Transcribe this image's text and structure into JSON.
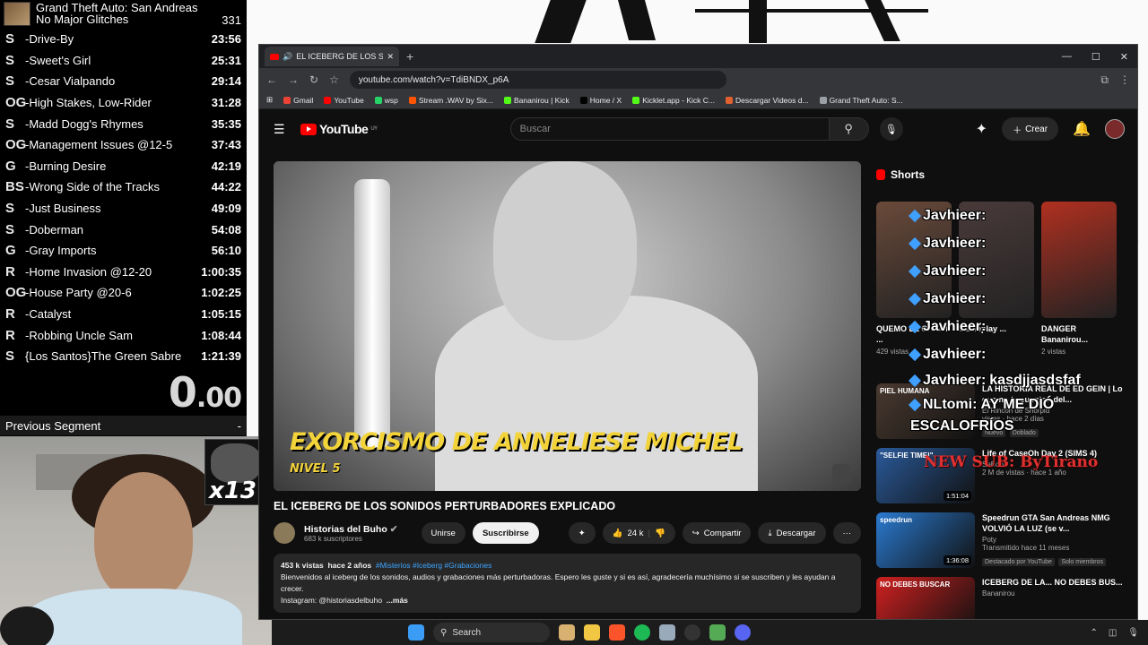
{
  "splits": {
    "game_title": "Grand Theft Auto: San Andreas",
    "category": "No Major Glitches",
    "attempts": "331",
    "rows": [
      {
        "icon": "S",
        "name": "-Drive-By",
        "time": "23:56"
      },
      {
        "icon": "S",
        "name": "-Sweet's Girl",
        "time": "25:31"
      },
      {
        "icon": "S",
        "name": "-Cesar Vialpando",
        "time": "29:14"
      },
      {
        "icon": "OG",
        "name": "-High Stakes, Low-Rider",
        "time": "31:28"
      },
      {
        "icon": "S",
        "name": "-Madd Dogg's Rhymes",
        "time": "35:35"
      },
      {
        "icon": "OG",
        "name": "-Management Issues @12-5",
        "time": "37:43"
      },
      {
        "icon": "G",
        "name": "-Burning Desire",
        "time": "42:19"
      },
      {
        "icon": "BS",
        "name": "-Wrong Side of the Tracks",
        "time": "44:22"
      },
      {
        "icon": "S",
        "name": "-Just Business",
        "time": "49:09"
      },
      {
        "icon": "S",
        "name": "-Doberman",
        "time": "54:08"
      },
      {
        "icon": "G",
        "name": "-Gray Imports",
        "time": "56:10"
      },
      {
        "icon": "R",
        "name": "-Home Invasion @12-20",
        "time": "1:00:35"
      },
      {
        "icon": "OG",
        "name": "-House Party @20-6",
        "time": "1:02:25"
      },
      {
        "icon": "R",
        "name": "-Catalyst",
        "time": "1:05:15"
      },
      {
        "icon": "R",
        "name": "-Robbing Uncle Sam",
        "time": "1:08:44"
      },
      {
        "icon": "S",
        "name": "{Los Santos}The Green Sabre",
        "time": "1:21:39"
      }
    ],
    "timer_main": "0",
    "timer_decimals": ".00",
    "previous_segment_label": "Previous Segment",
    "previous_segment_value": "-"
  },
  "webcam": {
    "sub_count": "x13"
  },
  "browser": {
    "tab_title": "EL ICEBERG DE LOS SONIDOS",
    "new_tab": "+",
    "url": "youtube.com/watch?v=TdiBNDX_p6A",
    "bookmarks": [
      {
        "label": "Gmail",
        "color": "#ea4335"
      },
      {
        "label": "YouTube",
        "color": "#ff0000"
      },
      {
        "label": "wsp",
        "color": "#25d366"
      },
      {
        "label": "Stream .WAV by Six...",
        "color": "#ff5500"
      },
      {
        "label": "Bananirou | Kick",
        "color": "#53fc18"
      },
      {
        "label": "Home / X",
        "color": "#000000"
      },
      {
        "label": "Kicklet.app - Kick C...",
        "color": "#53fc18"
      },
      {
        "label": "Descargar Videos d...",
        "color": "#e06030"
      },
      {
        "label": "Grand Theft Auto: S...",
        "color": "#9aa0a6"
      }
    ]
  },
  "youtube": {
    "logo_text": "YouTube",
    "region": "UY",
    "search_placeholder": "Buscar",
    "create_label": "Crear",
    "video": {
      "caption": "EXORCISMO DE ANNELIESE MICHEL",
      "sub_caption": "NIVEL 5",
      "title": "EL ICEBERG DE LOS SONIDOS PERTURBADORES EXPLICADO"
    },
    "channel": {
      "name": "Historias del Buho",
      "subscribers": "683 k suscriptores",
      "join_label": "Unirse",
      "subscribe_label": "Suscribirse"
    },
    "actions": {
      "likes": "24 k",
      "share": "Compartir",
      "download": "Descargar",
      "more": "···"
    },
    "description": {
      "views": "453 k vistas",
      "age": "hace 2 años",
      "tags": "#Misterios #Iceberg #Grabaciones",
      "text": "Bienvenidos al iceberg de los sonidos, audios y grabaciones más perturbadoras. Espero les guste y si es así, agradecería muchísimo si se suscriben y les ayudan a crecer.",
      "instagram": "Instagram: @historiasdelbuho",
      "more": "...más"
    },
    "shorts_heading": "Shorts",
    "shorts": [
      {
        "title": "QUEMO EL CHISTE ...",
        "views": "429 vistas",
        "color": "#6a4a3a"
      },
      {
        "title": "Gameplay ...",
        "views": "",
        "color": "#4a3a3a"
      },
      {
        "title": "DANGER Bananirou...",
        "views": "2 vistas",
        "color": "#b03020"
      }
    ],
    "related": [
      {
        "title": "LA HISTORIA REAL DE ED GEIN | Lo que no te cuentan del...",
        "channel": "El Rincón de Shorpid",
        "views": "vistas · hace 2 días",
        "badge": "Nuevo",
        "badge2": "Doblado",
        "duration": "",
        "thumb_text": "PIEL HUMANA",
        "color": "#4a3a30"
      },
      {
        "title": "Life of CaseOh Day 2 (SIMS 4)",
        "channel": "SeBoh",
        "views": "2 M de vistas · hace 1 año",
        "badge": "",
        "badge2": "",
        "duration": "1:51:04",
        "thumb_text": "\"SELFIE TIME!\"",
        "color": "#2a5a9a"
      },
      {
        "title": "Speedrun GTA San Andreas NMG VOLVIÓ LA LUZ (se v...",
        "channel": "Poty",
        "views": "Transmitido hace 11 meses",
        "badge": "Destacado por YouTube",
        "badge2": "Solo miembros",
        "duration": "1:36:08",
        "thumb_text": "speedrun",
        "color": "#2a7ad0"
      },
      {
        "title": "ICEBERG DE LA... NO DEBES BUS...",
        "channel": "Bananirou",
        "views": "",
        "badge": "",
        "badge2": "",
        "duration": "",
        "thumb_text": "NO DEBES BUSCAR",
        "color": "#d02020"
      }
    ]
  },
  "chat": {
    "lines": [
      {
        "user": "Javhieer:",
        "msg": ""
      },
      {
        "user": "Javhieer:",
        "msg": ""
      },
      {
        "user": "Javhieer:",
        "msg": ""
      },
      {
        "user": "Javhieer:",
        "msg": ""
      },
      {
        "user": "Javhieer:",
        "msg": ""
      },
      {
        "user": "Javhieer:",
        "msg": ""
      },
      {
        "user": "Javhieer:",
        "msg": "kasdjjasdsfaf"
      },
      {
        "user": "NLtomi:",
        "msg": "AY ME DIÓ"
      },
      {
        "user": "",
        "msg": "ESCALOFRÍOS"
      }
    ],
    "sub_alert": "NEW SUB: ByTirano"
  },
  "taskbar": {
    "search_label": "Search"
  }
}
